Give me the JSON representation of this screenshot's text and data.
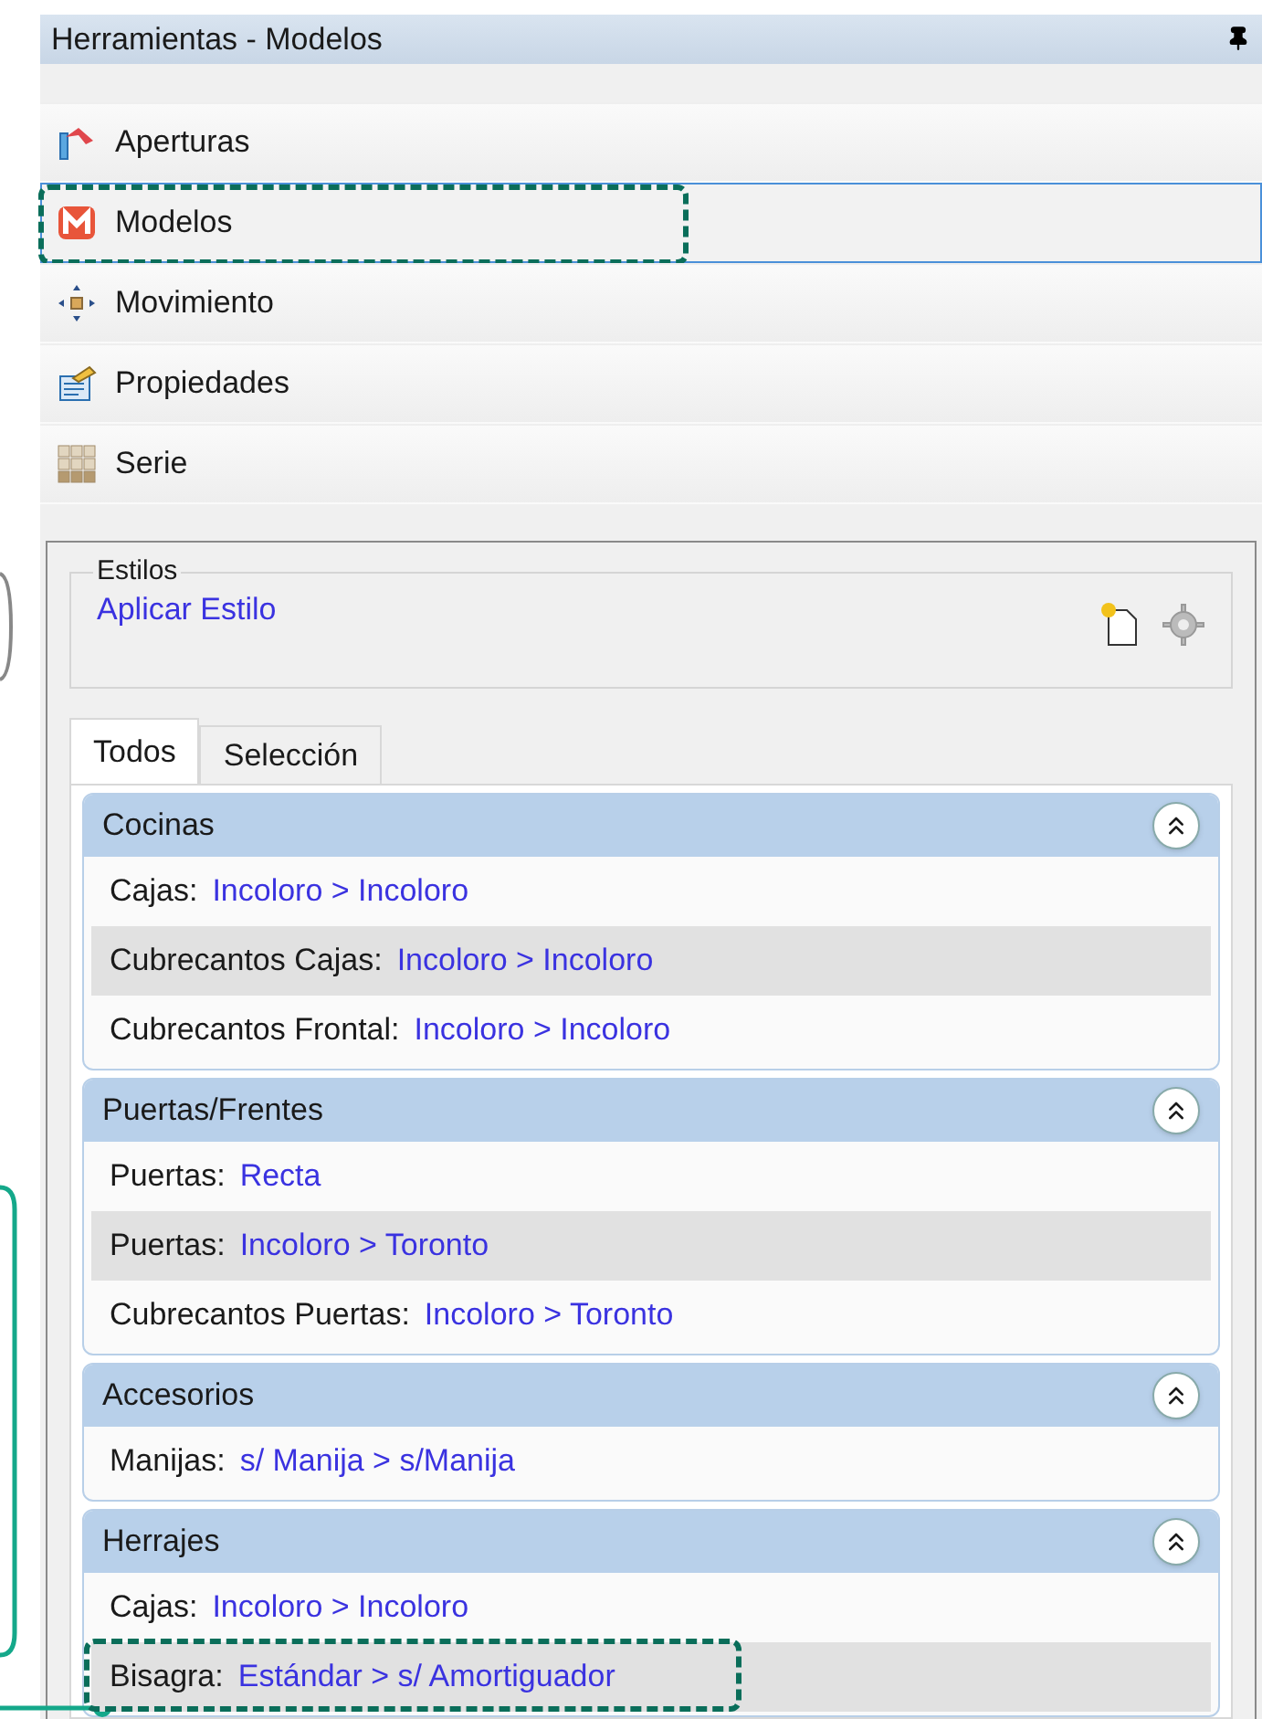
{
  "window": {
    "title": "Herramientas - Modelos"
  },
  "nav_items": [
    {
      "label": "Aperturas",
      "kind": "aperturas",
      "selected": false,
      "annotated": false
    },
    {
      "label": "Modelos",
      "kind": "modelos",
      "selected": true,
      "annotated": true
    },
    {
      "label": "Movimiento",
      "kind": "movimiento",
      "selected": false,
      "annotated": false
    },
    {
      "label": "Propiedades",
      "kind": "propiedades",
      "selected": false,
      "annotated": false
    },
    {
      "label": "Serie",
      "kind": "serie",
      "selected": false,
      "annotated": false
    }
  ],
  "styles_group": {
    "legend": "Estilos",
    "link": "Aplicar Estilo"
  },
  "tabs": [
    {
      "label": "Todos",
      "selected": true
    },
    {
      "label": "Selección",
      "selected": false
    }
  ],
  "sections": [
    {
      "title": "Cocinas",
      "expanded": true,
      "rows": [
        {
          "label": "Cajas:",
          "value": "Incoloro > Incoloro",
          "annotated": false
        },
        {
          "label": "Cubrecantos Cajas:",
          "value": "Incoloro > Incoloro",
          "annotated": false
        },
        {
          "label": "Cubrecantos Frontal:",
          "value": "Incoloro > Incoloro",
          "annotated": false
        }
      ]
    },
    {
      "title": "Puertas/Frentes",
      "expanded": true,
      "rows": [
        {
          "label": "Puertas:",
          "value": "Recta",
          "annotated": false
        },
        {
          "label": "Puertas:",
          "value": "Incoloro > Toronto",
          "annotated": false
        },
        {
          "label": "Cubrecantos Puertas:",
          "value": "Incoloro > Toronto",
          "annotated": false
        }
      ]
    },
    {
      "title": "Accesorios",
      "expanded": true,
      "rows": [
        {
          "label": "Manijas:",
          "value": "s/ Manija > s/Manija",
          "annotated": false
        }
      ]
    },
    {
      "title": "Herrajes",
      "expanded": true,
      "rows": [
        {
          "label": "Cajas:",
          "value": "Incoloro > Incoloro",
          "annotated": false
        },
        {
          "label": "Bisagra:",
          "value": "Estándar > s/ Amortiguador",
          "annotated": true
        }
      ]
    }
  ]
}
